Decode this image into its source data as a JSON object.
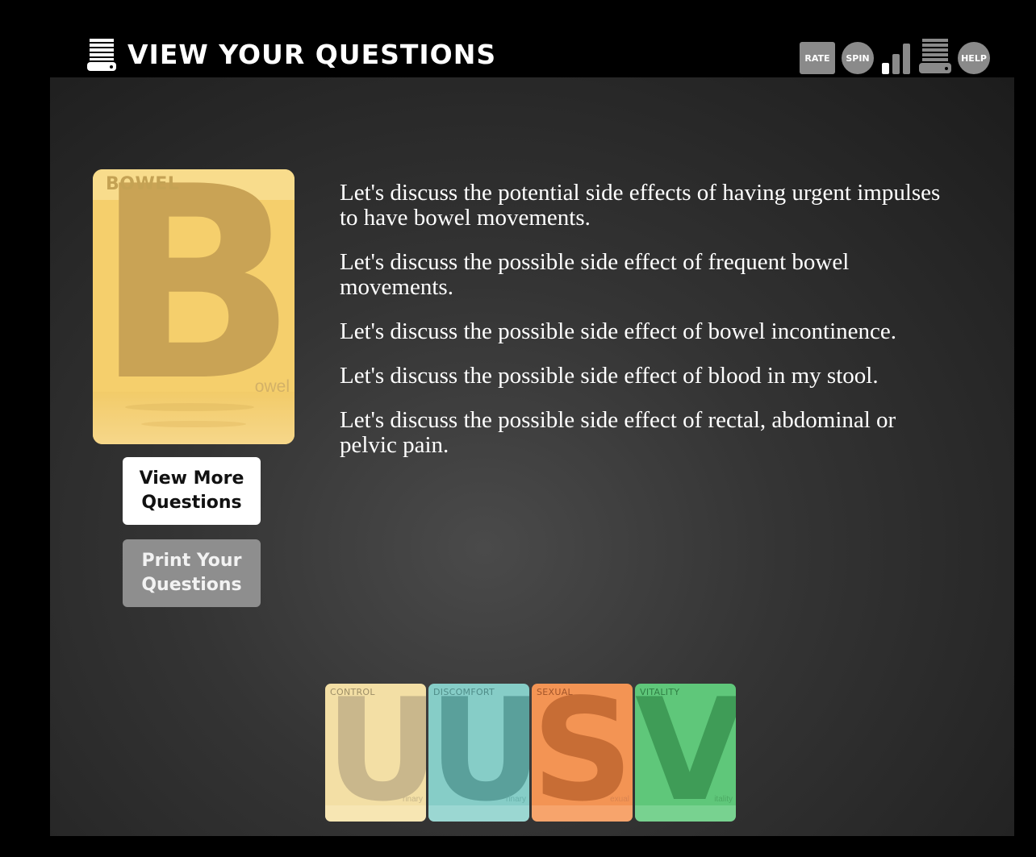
{
  "header": {
    "title": "VIEW YOUR QUESTIONS",
    "toolbar": {
      "rate_label": "RATE",
      "spin_label": "SPIN",
      "help_label": "HELP"
    }
  },
  "card": {
    "label": "BOWEL",
    "letter": "B",
    "word": "owel",
    "color": "#f5cf6c"
  },
  "buttons": {
    "view_more": "View More Questions",
    "print": "Print Your Questions"
  },
  "questions": [
    "Let's discuss the potential side effects of having urgent impulses to have bowel movements.",
    "Let's discuss the possible side effect of frequent bowel movements.",
    "Let's discuss the possible side effect of bowel incontinence.",
    "Let's discuss the possible side effect of blood in my stool.",
    "Let's discuss the possible side effect of rectal, abdominal or pelvic pain."
  ],
  "categories": [
    {
      "label": "CONTROL",
      "letter": "U",
      "word": "rinary",
      "color": "#f3dfa5"
    },
    {
      "label": "DISCOMFORT",
      "letter": "U",
      "word": "rinary",
      "color": "#86cdc7"
    },
    {
      "label": "SEXUAL",
      "letter": "S",
      "word": "exual",
      "color": "#f39454"
    },
    {
      "label": "VITALITY",
      "letter": "V",
      "word": "itality",
      "color": "#5fc77a"
    }
  ]
}
